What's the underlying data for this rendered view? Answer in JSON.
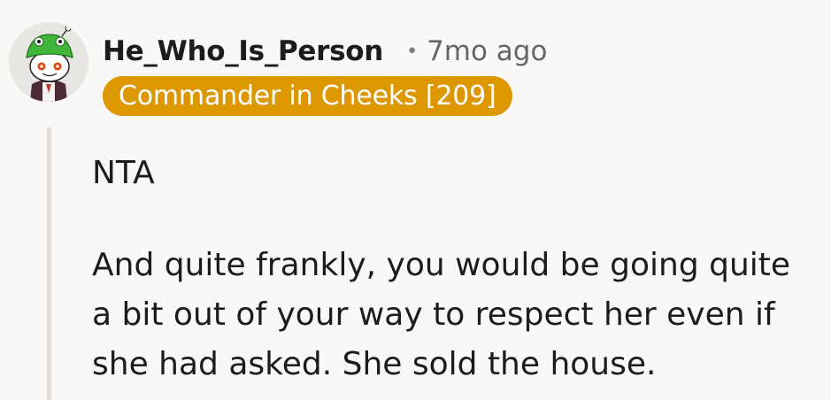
{
  "comment": {
    "author": "He_Who_Is_Person",
    "separator": "•",
    "timestamp": "7mo ago",
    "flair": "Commander in Cheeks [209]",
    "body": [
      "NTA",
      "And quite frankly, you would be going quite a bit out of your way to respect her even if she had asked. She sold the house."
    ]
  },
  "colors": {
    "background": "#f9f8f6",
    "flair_background": "#dd9700",
    "flair_text": "#ffffff",
    "thread_line": "#e6dcd6"
  },
  "icons": {
    "avatar": "reddit-snoo-avatar-with-green-frog-hat"
  }
}
